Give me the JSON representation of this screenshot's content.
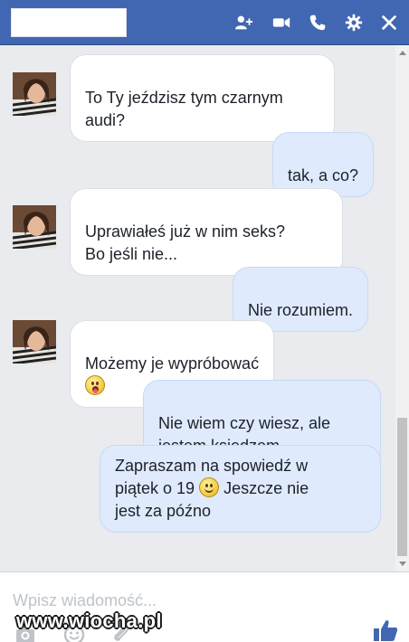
{
  "header": {
    "icons": [
      "add-person-icon",
      "video-call-icon",
      "phone-icon",
      "settings-gear-icon",
      "close-icon"
    ],
    "bg_color": "#4267b2"
  },
  "messages": [
    {
      "direction": "incoming",
      "text": "To Ty jeździsz tym czarnym\naudi?"
    },
    {
      "direction": "outgoing",
      "text": "tak, a co?"
    },
    {
      "direction": "incoming",
      "text": "Uprawiałeś już w nim seks?\nBo jeśli nie..."
    },
    {
      "direction": "outgoing",
      "text": "Nie rozumiem."
    },
    {
      "direction": "incoming",
      "text": "Możemy je wypróbować",
      "emoji": "tongue-emoji"
    },
    {
      "direction": "outgoing",
      "text": "Nie wiem czy wiesz, ale\njestem księdzem."
    },
    {
      "direction": "outgoing",
      "text_before": "Zapraszam na spowiedź w\npiątek o 19",
      "emoji": "smile-emoji",
      "text_after": "Jeszcze nie\njest za późno"
    }
  ],
  "composer": {
    "placeholder": "Wpisz wiadomość...",
    "tools": [
      "camera-icon",
      "emoji-icon",
      "attachment-icon"
    ],
    "like_icon": "thumbs-up-icon"
  },
  "watermark": "www.wiocha.pl",
  "colors": {
    "incoming_bubble": "#ffffff",
    "outgoing_bubble": "#dfeafc",
    "chat_bg": "#e9ebee",
    "like": "#4267b2"
  }
}
